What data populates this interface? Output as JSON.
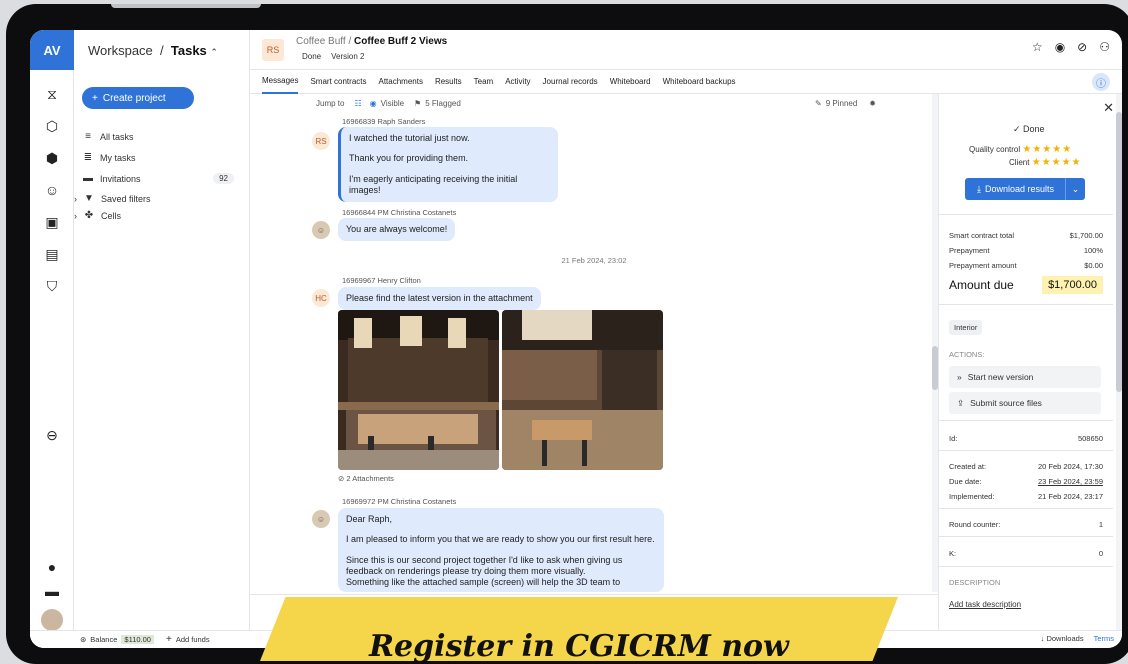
{
  "app": {
    "logo": "AV",
    "workspace": "Workspace",
    "separator": "/",
    "section": "Tasks"
  },
  "sidebar": {
    "create_label": "Create project",
    "items": [
      {
        "label": "All tasks",
        "icon": "list-icon"
      },
      {
        "label": "My tasks",
        "icon": "user-list-icon"
      },
      {
        "label": "Invitations",
        "icon": "mail-icon",
        "count": "92"
      },
      {
        "label": "Saved filters",
        "icon": "filter-icon"
      },
      {
        "label": "Cells",
        "icon": "cells-icon"
      }
    ]
  },
  "header": {
    "avatar": "RS",
    "breadcrumb_parent": "Coffee Buff",
    "breadcrumb_sep": " / ",
    "breadcrumb_current": "Coffee Buff 2 Views",
    "status": "Done",
    "version": "Version 2"
  },
  "tabs": [
    "Messages",
    "Smart contracts",
    "Attachments",
    "Results",
    "Team",
    "Activity",
    "Journal records",
    "Whiteboard",
    "Whiteboard backups"
  ],
  "chat_toolbar": {
    "jump": "Jump to",
    "visible": "Visible",
    "flagged": "5 Flagged",
    "pinned": "9 Pinned"
  },
  "messages": [
    {
      "meta": "16966839  Raph Sanders",
      "avatar": "RS",
      "lines": [
        "I watched the tutorial just now.",
        "Thank you for providing them.",
        "I'm eagerly anticipating receiving the initial images!"
      ]
    },
    {
      "meta": "16966844  PM Christina Costanets",
      "lines": [
        "You are always welcome!"
      ]
    },
    {
      "date": "21 Feb 2024, 23:02"
    },
    {
      "meta": "16969967  Henry Clifton",
      "avatar": "HC",
      "lines": [
        "Please find the latest version in the attachment"
      ],
      "attachments": "2 Attachments"
    },
    {
      "meta": "16969972  PM Christina Costanets",
      "lines": [
        "Dear Raph,",
        "I am pleased to inform you that we are ready to show you our first result here.",
        "Since this is our second project together I'd like to ask when giving us feedback on renderings please try doing them more visually.",
        "Something like the attached sample (screen) will help the 3D team to"
      ]
    }
  ],
  "panel": {
    "status": "Done",
    "quality_label": "Quality control",
    "client_label": "Client",
    "rating_quality": 5,
    "rating_client": 5,
    "download": "Download results",
    "rows": [
      {
        "label": "Smart contract total",
        "value": "$1,700.00"
      },
      {
        "label": "Prepayment",
        "value": "100%"
      },
      {
        "label": "Prepayment amount",
        "value": "$0.00"
      }
    ],
    "amount_due_label": "Amount due",
    "amount_due_value": "$1,700.00",
    "tag": "Interior",
    "actions_label": "ACTIONS:",
    "actions": [
      "Start new version",
      "Submit source files"
    ],
    "id_label": "Id:",
    "id_value": "508650",
    "created_label": "Created at:",
    "created_value": "20 Feb 2024, 17:30",
    "due_label": "Due date:",
    "due_value": "23 Feb 2024, 23:59",
    "implemented_label": "Implemented:",
    "implemented_value": "21 Feb 2024, 23:17",
    "round_label": "Round counter:",
    "round_value": "1",
    "k_label": "K:",
    "k_value": "0",
    "description_label": "DESCRIPTION",
    "add_description": "Add task description"
  },
  "bottom": {
    "balance_label": "Balance",
    "balance_value": "$110.00",
    "add_funds": "Add funds",
    "downloads": "Downloads",
    "terms": "Terms"
  },
  "banner": "Register in CGICRM now",
  "colors": {
    "accent": "#2f73d9",
    "star": "#f0b400",
    "highlight": "#fdf2b0",
    "banner": "#f5d64a"
  }
}
